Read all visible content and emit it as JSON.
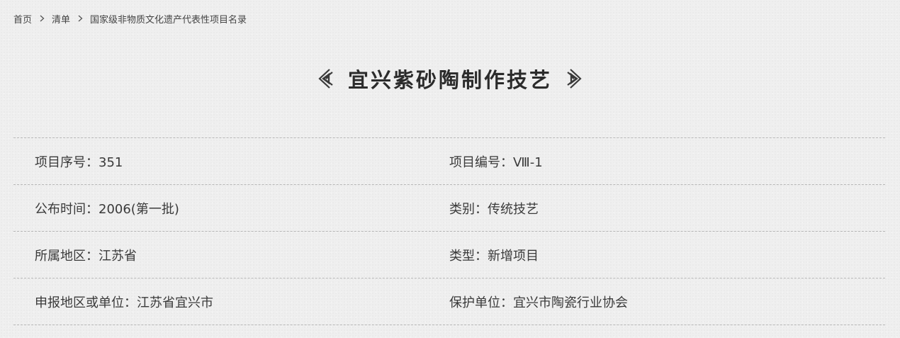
{
  "breadcrumb": {
    "home": "首页",
    "list": "清单",
    "current": "国家级非物质文化遗产代表性项目名录"
  },
  "title": "宜兴紫砂陶制作技艺",
  "info": {
    "row1": {
      "left": "项目序号：351",
      "right": "项目编号：Ⅷ-1"
    },
    "row2": {
      "left": "公布时间：2006(第一批)",
      "right": "类别：传统技艺"
    },
    "row3": {
      "left": "所属地区：江苏省",
      "right": "类型：新增项目"
    },
    "row4": {
      "left": "申报地区或单位：江苏省宜兴市",
      "right": "保护单位：宜兴市陶瓷行业协会"
    }
  },
  "icons": {
    "breadcrumb_separator": "chevron-right-icon",
    "title_ornaments": "fret-ornament-icon"
  },
  "colors": {
    "background": "#efefef",
    "text": "#333333",
    "divider": "#b7b7b7"
  }
}
